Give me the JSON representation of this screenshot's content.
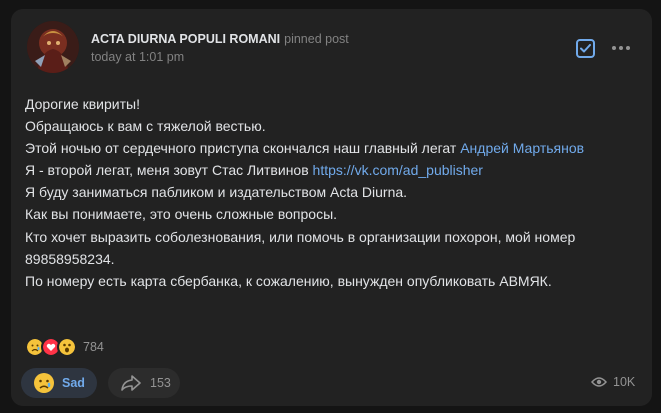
{
  "post": {
    "author": "ACTA DIURNA POPULI ROMANI",
    "pinned_label": "pinned post",
    "time": "today at 1:01 pm",
    "lines": {
      "l1": "Дорогие квириты!",
      "l2": "Обращаюсь к вам с тяжелой вестью.",
      "l3_pre": "Этой ночью от сердечного приступа скончался наш главный легат ",
      "l3_link": "Андрей Мартьянов",
      "l4_pre": "Я - второй легат, меня зовут Стас Литвинов ",
      "l4_link": "https://vk.com/ad_publisher",
      "l5": "Я буду заниматься пабликом и издательством Acta Diurna.",
      "l6": "Как вы понимаете, это очень сложные вопросы.",
      "l7": "Кто хочет выразить соболезнования, или помочь в организации похорон, мой номер 89858958234.",
      "l8": "По номеру есть карта сбербанка, к сожалению, вынужден опубликовать АВМЯК."
    }
  },
  "reactions": {
    "emojis": [
      "sad-face-emoji",
      "heart-emoji",
      "shocked-face-emoji"
    ],
    "count": "784"
  },
  "actions": {
    "sad_label": "Sad",
    "share_count": "153",
    "views": "10K"
  },
  "colors": {
    "background": "#141414",
    "card": "#222222",
    "link": "#71aaeb",
    "muted": "#828282"
  }
}
